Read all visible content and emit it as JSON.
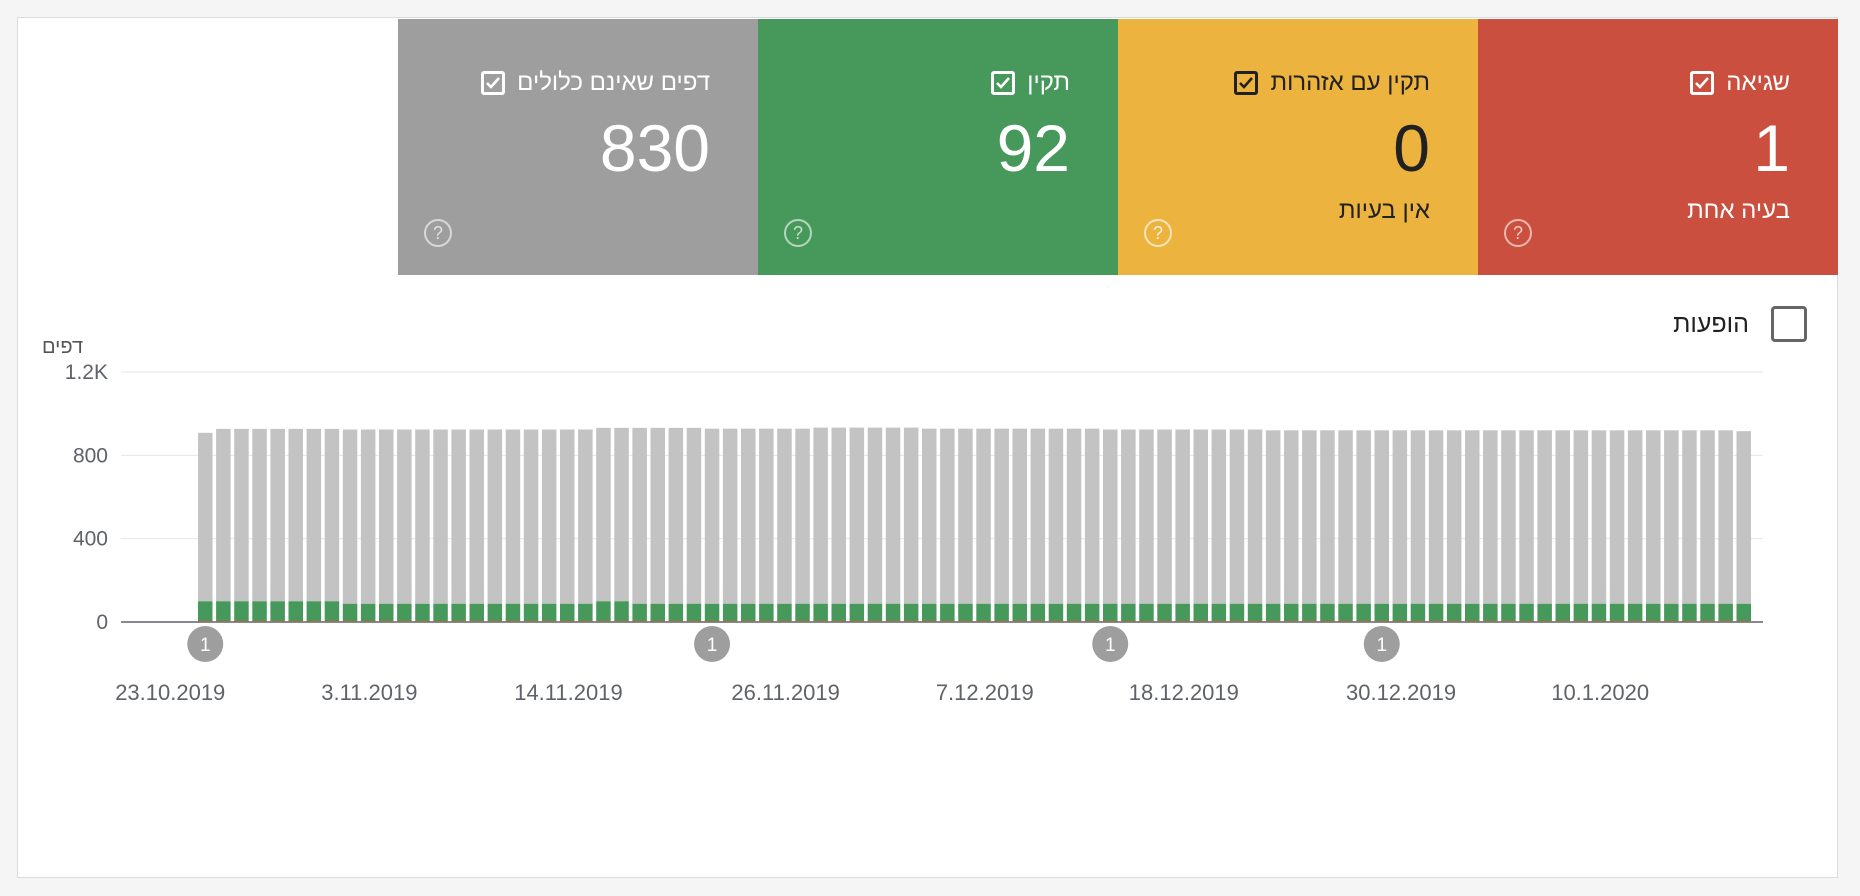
{
  "colors": {
    "error": "#cb4f3e",
    "warning": "#ecb33e",
    "valid": "#47995b",
    "excluded": "#9e9e9e",
    "bar_excluded": "#c3c3c3",
    "bar_valid": "#47995b",
    "bar_error": "#cb4f3e"
  },
  "tiles": [
    {
      "key": "excluded",
      "label": "דפים שאינם כלולים",
      "count": "830",
      "sub": "",
      "icon": "question-icon"
    },
    {
      "key": "valid",
      "label": "תקין",
      "count": "92",
      "sub": "",
      "icon": "question-icon"
    },
    {
      "key": "warning",
      "label": "תקין עם אזהרות",
      "count": "0",
      "sub": "אין בעיות",
      "icon": "question-icon"
    },
    {
      "key": "error",
      "label": "שגיאה",
      "count": "1",
      "sub": "בעיה אחת",
      "icon": "question-icon"
    }
  ],
  "impressions": {
    "label": "הופעות",
    "checked": false
  },
  "chart_data": {
    "type": "bar",
    "stacked": true,
    "ylabel": "דפים",
    "ylim": [
      0,
      1200
    ],
    "y_ticks": [
      "0",
      "400",
      "800",
      "1.2K"
    ],
    "x_tick_labels": [
      "23.10.2019",
      "3.11.2019",
      "14.11.2019",
      "26.11.2019",
      "7.12.2019",
      "18.12.2019",
      "30.12.2019",
      "10.1.2020"
    ],
    "x_tick_indices": [
      0,
      11,
      22,
      34,
      45,
      56,
      68,
      79
    ],
    "grid": true,
    "annotations": [
      {
        "index": 0,
        "label": "1"
      },
      {
        "index": 28,
        "label": "1"
      },
      {
        "index": 50,
        "label": "1"
      },
      {
        "index": 65,
        "label": "1"
      }
    ],
    "categories_count": 86,
    "series": [
      {
        "name": "שגיאה",
        "values": [
          4,
          4,
          4,
          4,
          4,
          4,
          4,
          4,
          4,
          4,
          4,
          4,
          4,
          4,
          4,
          4,
          4,
          4,
          4,
          4,
          4,
          4,
          4,
          4,
          4,
          4,
          4,
          4,
          4,
          4,
          4,
          4,
          4,
          4,
          4,
          4,
          4,
          4,
          4,
          4,
          4,
          4,
          4,
          4,
          4,
          4,
          4,
          4,
          4,
          4,
          4,
          4,
          4,
          4,
          4,
          4,
          4,
          4,
          4,
          4,
          4,
          4,
          4,
          4,
          4,
          4,
          4,
          4,
          4,
          4,
          4,
          4,
          4,
          4,
          4,
          4,
          4,
          4,
          4,
          4,
          4,
          4,
          4,
          4,
          4,
          4
        ]
      },
      {
        "name": "תקין",
        "values": [
          96,
          96,
          96,
          96,
          96,
          96,
          96,
          96,
          84,
          84,
          84,
          84,
          84,
          84,
          84,
          84,
          84,
          84,
          84,
          84,
          84,
          84,
          96,
          96,
          84,
          84,
          84,
          84,
          84,
          84,
          84,
          84,
          84,
          84,
          84,
          84,
          84,
          84,
          84,
          84,
          84,
          84,
          84,
          84,
          84,
          84,
          84,
          84,
          84,
          84,
          84,
          84,
          84,
          84,
          84,
          84,
          84,
          84,
          84,
          84,
          84,
          84,
          84,
          84,
          84,
          84,
          84,
          84,
          84,
          84,
          84,
          84,
          84,
          84,
          84,
          84,
          84,
          84,
          84,
          84,
          84,
          84,
          84,
          84,
          84,
          84
        ]
      },
      {
        "name": "דפים שאינם כלולים",
        "values": [
          808,
          827,
          827,
          827,
          827,
          827,
          827,
          827,
          836,
          836,
          836,
          836,
          836,
          836,
          836,
          836,
          836,
          836,
          836,
          836,
          836,
          836,
          832,
          832,
          844,
          844,
          844,
          844,
          840,
          840,
          840,
          840,
          840,
          840,
          845,
          845,
          845,
          845,
          845,
          845,
          840,
          840,
          840,
          840,
          840,
          840,
          840,
          840,
          840,
          840,
          836,
          836,
          836,
          836,
          836,
          836,
          836,
          836,
          836,
          832,
          832,
          832,
          832,
          832,
          832,
          832,
          832,
          832,
          832,
          832,
          832,
          832,
          832,
          832,
          832,
          832,
          832,
          832,
          832,
          832,
          832,
          832,
          832,
          832,
          832,
          828
        ]
      }
    ]
  }
}
